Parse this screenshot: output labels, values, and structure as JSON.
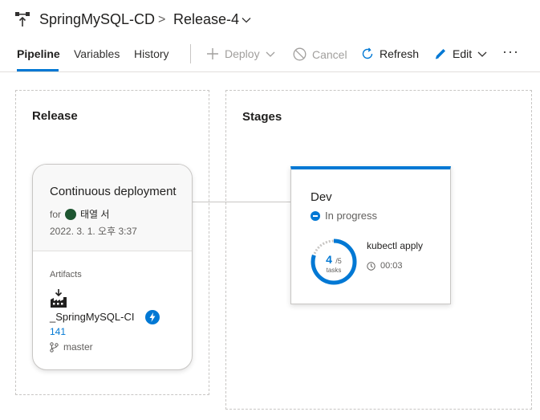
{
  "header": {
    "project": "SpringMySQL-CD",
    "separator": ">",
    "release": "Release-4"
  },
  "tabs": [
    {
      "label": "Pipeline",
      "active": true
    },
    {
      "label": "Variables",
      "active": false
    },
    {
      "label": "History",
      "active": false
    }
  ],
  "toolbar": {
    "deploy": "Deploy",
    "cancel": "Cancel",
    "refresh": "Refresh",
    "edit": "Edit",
    "more": "···"
  },
  "release_panel": {
    "title": "Release",
    "trigger": "Continuous deployment",
    "for_label": "for",
    "user": "태열 서",
    "date": "2022. 3. 1. 오후 3:37",
    "artifacts_label": "Artifacts",
    "artifact_name": "_SpringMySQL-CI",
    "build_number": "141",
    "branch": "master"
  },
  "stages_panel": {
    "title": "Stages",
    "stage": {
      "name": "Dev",
      "status": "In progress",
      "tasks_done": "4",
      "tasks_total": "/5",
      "tasks_label": "tasks",
      "tasks_fraction": 0.8,
      "current_task": "kubectl apply",
      "elapsed": "00:03"
    }
  },
  "colors": {
    "accent": "#0078d4",
    "text": "#201f1e",
    "muted": "#605e5c",
    "border": "#c8c6c4"
  }
}
